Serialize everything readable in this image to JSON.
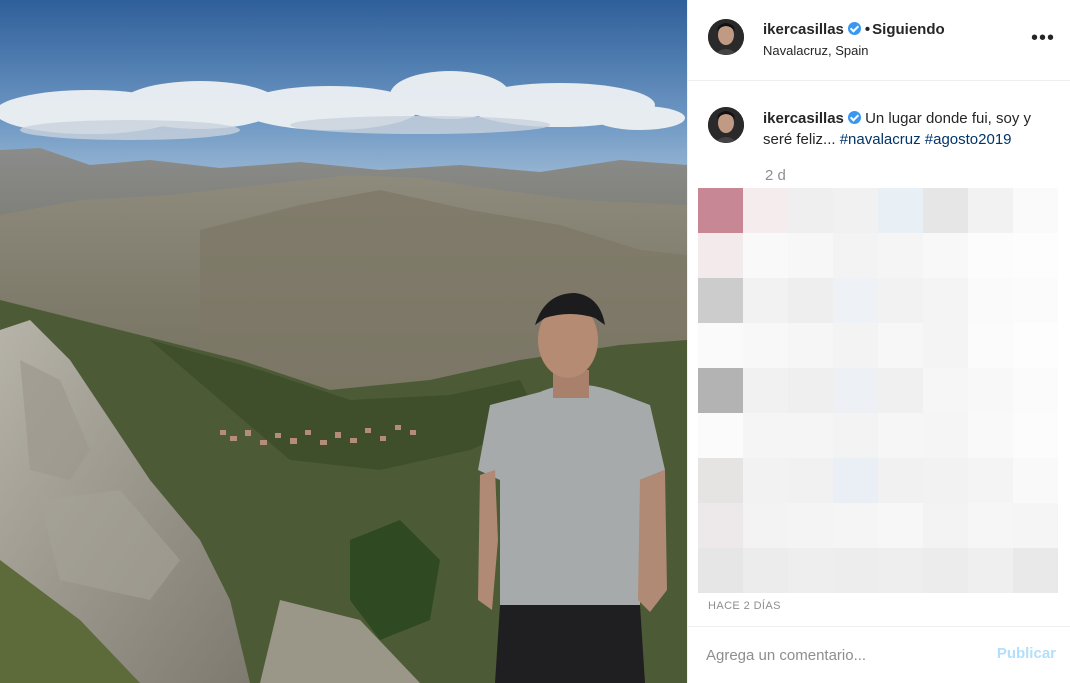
{
  "post": {
    "username": "ikercasillas",
    "verified": true,
    "separator": "•",
    "follow_status": "Siguiendo",
    "location": "Navalacruz, Spain",
    "more_icon": "more-horizontal-icon",
    "more_glyph": "•••"
  },
  "caption": {
    "username": "ikercasillas",
    "text": " Un lugar donde fui, soy y seré feliz... ",
    "hashtags": [
      "#navalacruz",
      "#agosto2019"
    ],
    "time_ago": "2 d"
  },
  "comments_area": {
    "note": "",
    "pixelated_colors": [
      [
        "#c88794",
        "#f5ecee",
        "#efeff0",
        "#f1f1f2",
        "#e8eff5",
        "#e6e6e6",
        "#f2f2f2",
        "#fafafa"
      ],
      [
        "#f3eaec",
        "#f9f9f9",
        "#f7f7f7",
        "#f3f3f3",
        "#f5f5f5",
        "#f8f8f8",
        "#fcfcfc",
        "#fdfdfd"
      ],
      [
        "#cccccc",
        "#f2f2f2",
        "#eeeeee",
        "#eef1f5",
        "#f2f2f2",
        "#f4f4f4",
        "#fafafa",
        "#fbfbfb"
      ],
      [
        "#fafafa",
        "#f8f8f8",
        "#f6f6f6",
        "#f3f3f3",
        "#f7f7f7",
        "#f4f4f4",
        "#fbfbfb",
        "#fdfdfd"
      ],
      [
        "#b3b3b3",
        "#f1f1f1",
        "#efefef",
        "#edf1f5",
        "#f0f0f0",
        "#f6f6f6",
        "#f8f8f8",
        "#fbfbfb"
      ],
      [
        "#fbfbfb",
        "#f5f5f5",
        "#f5f5f5",
        "#f3f3f3",
        "#f6f6f6",
        "#f5f5f5",
        "#f9f9f9",
        "#fcfcfc"
      ],
      [
        "#e6e3e3",
        "#f2f2f2",
        "#f1f1f1",
        "#e9eff5",
        "#f1f1f1",
        "#f2f2f2",
        "#f4f4f4",
        "#f9f9f9"
      ],
      [
        "#ede9ea",
        "#f3f3f3",
        "#f4f4f4",
        "#f5f5f5",
        "#f7f7f7",
        "#f3f3f3",
        "#f6f6f6",
        "#f5f5f5"
      ],
      [
        "#e6e6e6",
        "#ececec",
        "#eeeeee",
        "#ededed",
        "#eeeeee",
        "#ececec",
        "#efefef",
        "#e9e9e9"
      ]
    ]
  },
  "date_label": "HACE 2 DÍAS",
  "comment": {
    "placeholder": "Agrega un comentario...",
    "publish_label": "Publicar"
  },
  "colors": {
    "accent": "#3897f0",
    "hashtag": "#003569",
    "publish_disabled": "#b2dffc",
    "muted": "#8e8e8e"
  }
}
